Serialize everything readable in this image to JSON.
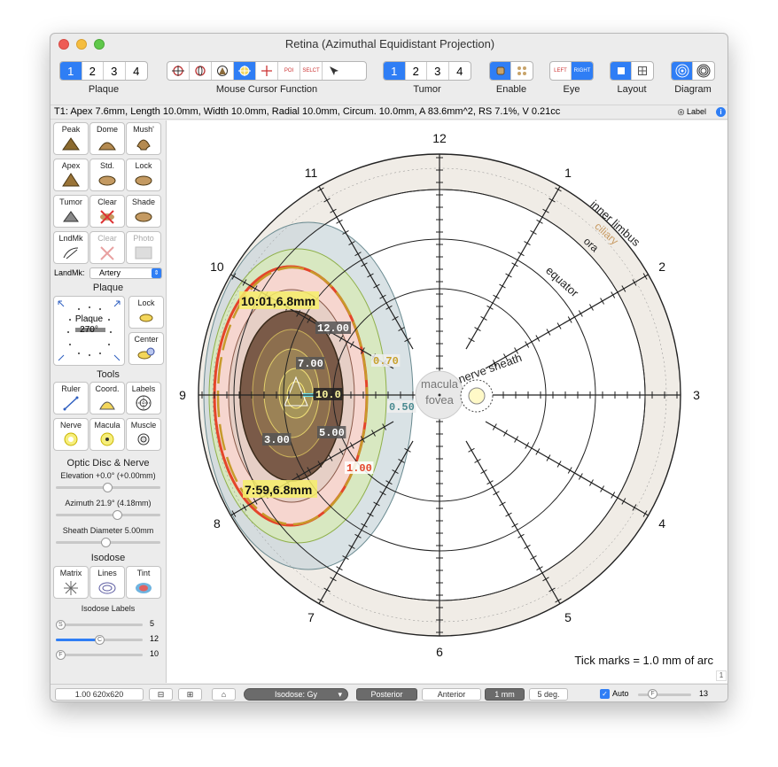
{
  "window": {
    "title": "Retina (Azimuthal Equidistant Projection)"
  },
  "toolbar": {
    "plaque": {
      "label": "Plaque",
      "options": [
        "1",
        "2",
        "3",
        "4"
      ],
      "selected": "1"
    },
    "mouse": {
      "label": "Mouse Cursor Function",
      "poi_label": "POI",
      "select_label": "SELCT"
    },
    "tumor": {
      "label": "Tumor",
      "options": [
        "1",
        "2",
        "3",
        "4"
      ],
      "selected": "1"
    },
    "enable": {
      "label": "Enable"
    },
    "eye": {
      "label": "Eye",
      "left": "LEFT",
      "right": "RIGHT"
    },
    "layout": {
      "label": "Layout"
    },
    "diagram": {
      "label": "Diagram"
    }
  },
  "status": {
    "text": "T1: Apex 7.6mm, Length 10.0mm, Width 10.0mm, Radial 10.0mm, Circum. 10.0mm, A 83.6mm^2, RS 7.1%, V 0.21cc",
    "label_toggle": "Label"
  },
  "sidebar": {
    "shape_buttons": [
      {
        "label": "Peak"
      },
      {
        "label": "Dome"
      },
      {
        "label": "Mush'"
      },
      {
        "label": "Apex"
      },
      {
        "label": "Std."
      },
      {
        "label": "Lock"
      },
      {
        "label": "Tumor"
      },
      {
        "label": "Clear"
      },
      {
        "label": "Shade"
      },
      {
        "label": "LndMk"
      },
      {
        "label": "Clear"
      },
      {
        "label": "Photo"
      }
    ],
    "landmark_label": "LandMk:",
    "landmark_value": "Artery",
    "plaque_section": "Plaque",
    "plaque_box_title": "Plaque",
    "plaque_box_angle": "270°",
    "plaque_lock": "Lock",
    "plaque_center": "Center",
    "tools_section": "Tools",
    "tools": [
      {
        "label": "Ruler"
      },
      {
        "label": "Coord."
      },
      {
        "label": "Labels"
      },
      {
        "label": "Nerve"
      },
      {
        "label": "Macula"
      },
      {
        "label": "Muscle"
      }
    ],
    "optic_section": "Optic Disc & Nerve",
    "elevation": "Elevation +0.0° (+0.00mm)",
    "azimuth": "Azimuth 21.9° (4.18mm)",
    "sheath": "Sheath Diameter 5.00mm",
    "isodose_section": "Isodose",
    "isodose_buttons": [
      {
        "label": "Matrix"
      },
      {
        "label": "Lines"
      },
      {
        "label": "Tint"
      }
    ],
    "isodose_labels_title": "Isodose Labels",
    "iso_sliders": [
      {
        "knob": "S",
        "value": "5",
        "level": 0.05
      },
      {
        "knob": "C",
        "value": "12",
        "level": 0.5
      },
      {
        "knob": "F",
        "value": "10",
        "level": 0.05
      }
    ]
  },
  "diagram": {
    "clock_numbers": [
      "12",
      "1",
      "2",
      "3",
      "4",
      "5",
      "6",
      "7",
      "8",
      "9",
      "10",
      "11"
    ],
    "ring_labels": {
      "inner_limbus": "inner limbus",
      "ciliary": "ciliary",
      "ora": "ora",
      "equator": "equator",
      "nerve_sheath": "nerve sheath"
    },
    "macula": "macula",
    "fovea": "fovea",
    "isodose_values": [
      "12.00",
      "7.00",
      "10.0",
      "5.00",
      "3.00",
      "1.00",
      "0.70",
      "0.50"
    ],
    "callout_top": "10:01,6.8mm",
    "callout_bottom": "7:59,6.8mm",
    "tick_caption": "Tick marks = 1.0 mm of arc",
    "page_index": "1"
  },
  "bottom": {
    "scale": "1.00 620x620",
    "isodose_select": "Isodose: Gy",
    "view_options": [
      "Posterior",
      "Anterior"
    ],
    "view_selected": "Posterior",
    "unit_options": [
      "1 mm",
      "5 deg."
    ],
    "unit_selected": "1 mm",
    "auto_label": "Auto",
    "auto_knob": "F",
    "auto_value": "13"
  },
  "colors": {
    "accent": "#2f7ef5",
    "iso_red": "#e4452a",
    "iso_gold": "#c79a2a",
    "tumor_brown": "#7a5a48"
  }
}
